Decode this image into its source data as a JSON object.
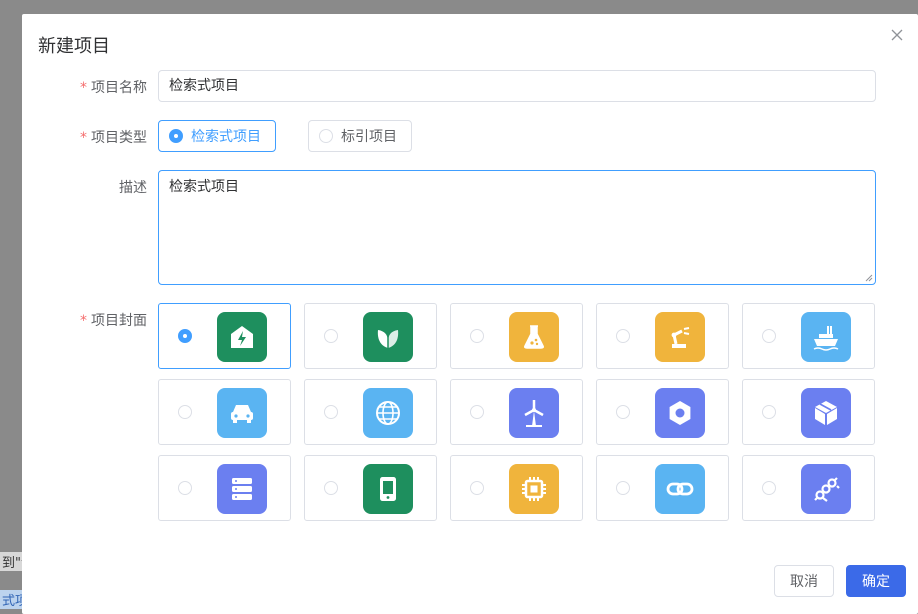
{
  "background": {
    "fragment_1": "到\"专",
    "fragment_2": "式项"
  },
  "dialog": {
    "title": "新建项目",
    "cancel_label": "取消",
    "confirm_label": "确定"
  },
  "form": {
    "name": {
      "required_mark": "*",
      "label": "项目名称",
      "value": "检索式项目"
    },
    "type": {
      "required_mark": "*",
      "label": "项目类型",
      "options": [
        "检索式项目",
        "标引项目"
      ],
      "selected": "检索式项目"
    },
    "description": {
      "label": "描述",
      "value": "检索式项目"
    },
    "cover": {
      "required_mark": "*",
      "label": "项目封面",
      "selected_index": 0,
      "options": [
        {
          "icon": "house-energy-icon",
          "color": "#1e8f5e"
        },
        {
          "icon": "leaf-icon",
          "color": "#1e8f5e"
        },
        {
          "icon": "flask-icon",
          "color": "#f0b43c"
        },
        {
          "icon": "robot-arm-icon",
          "color": "#f0b43c"
        },
        {
          "icon": "ship-icon",
          "color": "#5ab4f2"
        },
        {
          "icon": "car-icon",
          "color": "#5ab4f2"
        },
        {
          "icon": "globe-icon",
          "color": "#5ab4f2"
        },
        {
          "icon": "wind-turbine-icon",
          "color": "#6b7ff0"
        },
        {
          "icon": "hex-nut-icon",
          "color": "#6b7ff0"
        },
        {
          "icon": "cube-icon",
          "color": "#6b7ff0"
        },
        {
          "icon": "server-icon",
          "color": "#6b7ff0"
        },
        {
          "icon": "tablet-icon",
          "color": "#1e8f5e"
        },
        {
          "icon": "chip-icon",
          "color": "#f0b43c"
        },
        {
          "icon": "link-icon",
          "color": "#5ab4f2"
        },
        {
          "icon": "pipes-icon",
          "color": "#6b7ff0"
        }
      ]
    }
  }
}
